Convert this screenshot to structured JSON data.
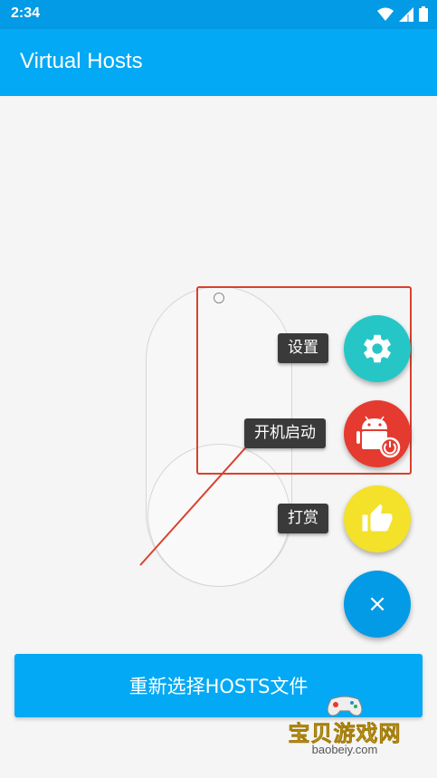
{
  "status_bar": {
    "time": "2:34"
  },
  "app_bar": {
    "title": "Virtual Hosts"
  },
  "fab_menu": {
    "settings_label": "设置",
    "autostart_label": "开机启动",
    "donate_label": "打赏",
    "close_icon": "×"
  },
  "bottom": {
    "reselect_label": "重新选择HOSTS文件"
  },
  "watermark": {
    "text": "宝贝游戏网",
    "url": "baobeiy.com"
  },
  "colors": {
    "primary": "#03a9f4",
    "status_bar": "#039be5",
    "settings_fab": "#26c6c6",
    "autostart_fab": "#e53a2f",
    "donate_fab": "#f4e12a",
    "highlight": "#d9412d"
  },
  "icons": [
    "wifi-icon",
    "signal-icon",
    "battery-icon",
    "gear-icon",
    "android-power-icon",
    "thumbs-up-icon",
    "close-icon"
  ]
}
